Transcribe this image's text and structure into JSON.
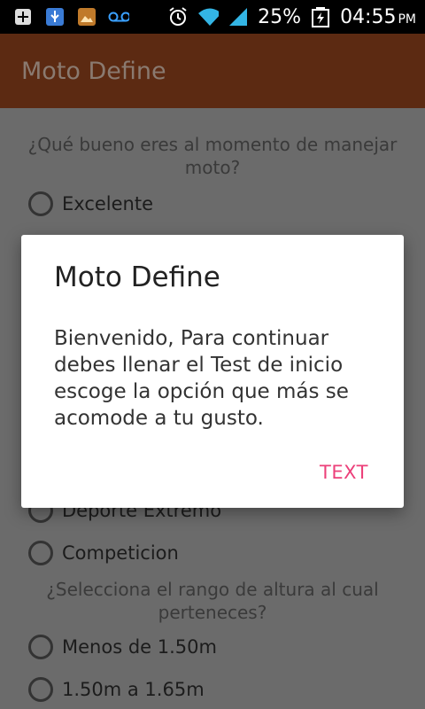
{
  "status_bar": {
    "icons_left": [
      "add-box-icon",
      "usb-icon",
      "gallery-icon",
      "voicemail-icon"
    ],
    "icons_right": [
      "alarm-icon",
      "wifi-icon",
      "signal-icon",
      "battery-charging-icon"
    ],
    "battery": "25%",
    "time": "04:55",
    "ampm": "PM"
  },
  "app_bar": {
    "title": "Moto Define"
  },
  "form": {
    "q1": "¿Qué bueno eres al momento de manejar moto?",
    "q1_options": [
      "Excelente",
      "Deporte Extremo",
      "Competicion"
    ],
    "q2": "¿Selecciona el rango de altura al cual perteneces?",
    "q2_options": [
      "Menos de 1.50m",
      "1.50m a 1.65m"
    ]
  },
  "dialog": {
    "title": "Moto Define",
    "message": "Bienvenido, Para continuar debes llenar el Test de inicio escoge la opción que más se acomode a tu gusto.",
    "button": "TEXT"
  },
  "colors": {
    "app_bar": "#5c2a12",
    "accent": "#ec407a"
  }
}
